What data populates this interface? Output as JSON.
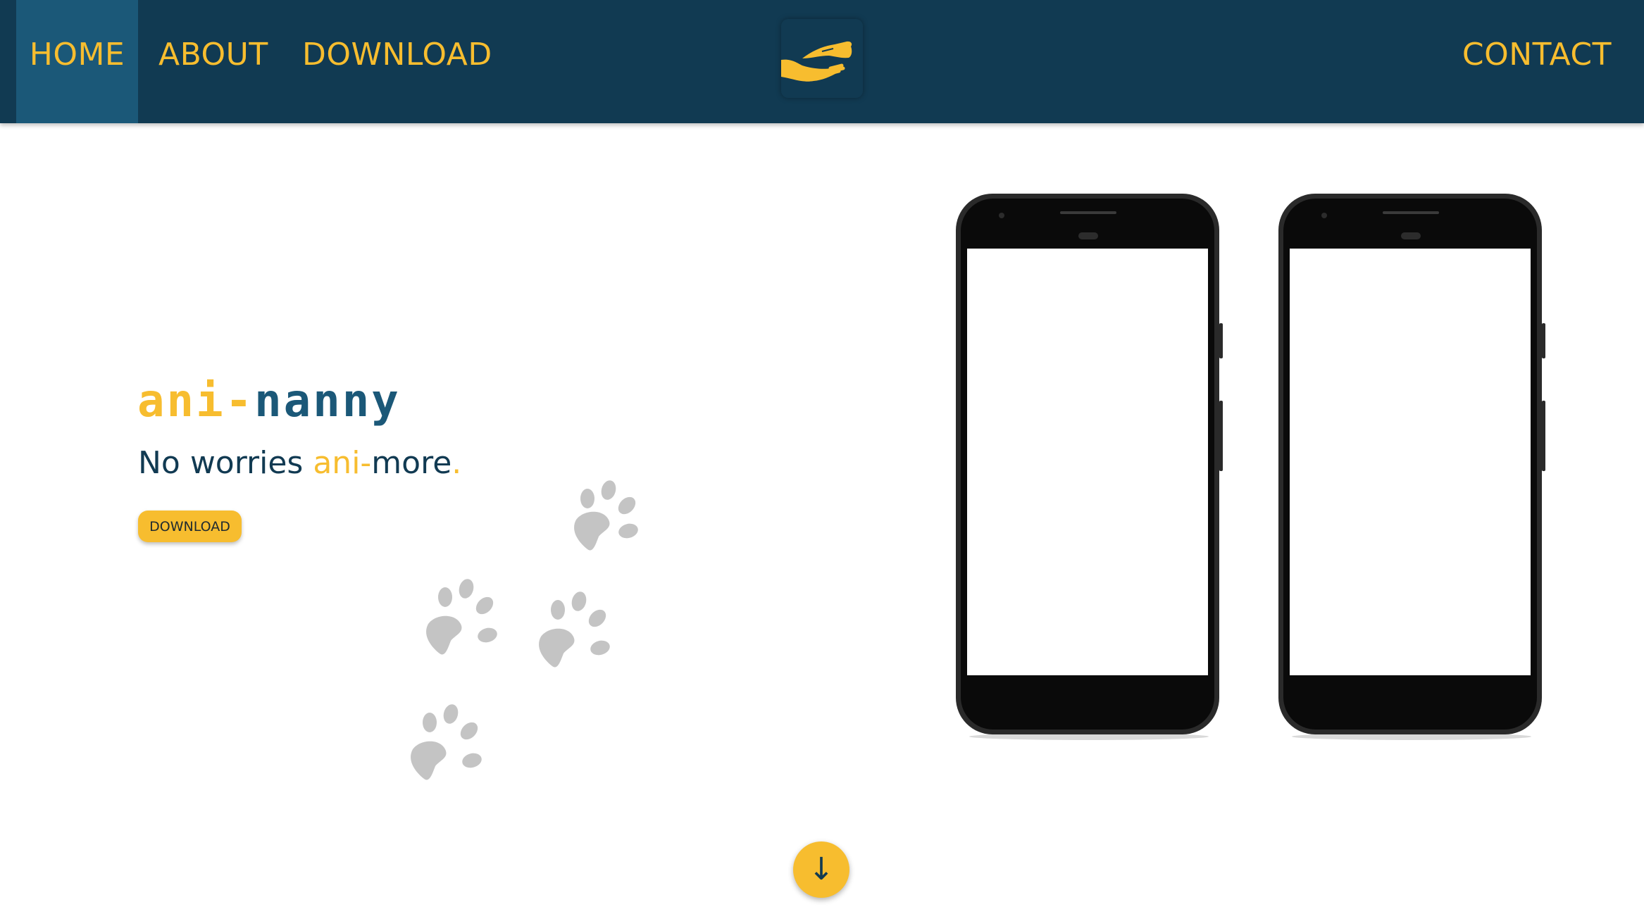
{
  "nav": {
    "home": "HOME",
    "about": "ABOUT",
    "download": "DOWNLOAD",
    "contact": "CONTACT"
  },
  "logo": {
    "icon": "hands-icon"
  },
  "hero": {
    "brand_part1": "ani-",
    "brand_part2": "nanny",
    "tagline_part1": "No worries ",
    "tagline_part2": "ani-",
    "tagline_part3": "more",
    "tagline_part4": ".",
    "download_button": "DOWNLOAD"
  },
  "scroll_down": {
    "label": "↓"
  },
  "colors": {
    "navy": "#113a52",
    "active_tab": "#1b5878",
    "accent_yellow": "#f7bd2f",
    "paw_gray": "#c4c4c4"
  }
}
